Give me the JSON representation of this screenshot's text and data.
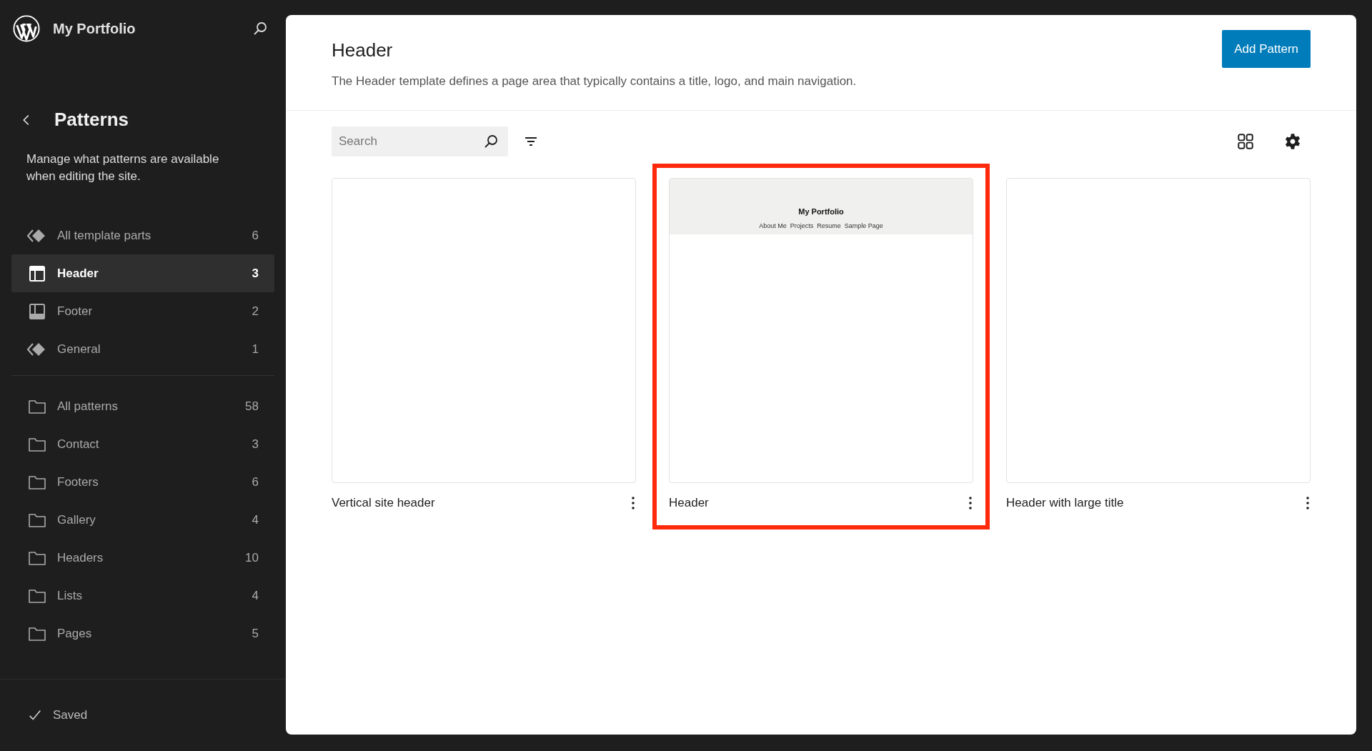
{
  "sidebar": {
    "site_title": "My Portfolio",
    "heading": "Patterns",
    "description": "Manage what patterns are available when editing the site.",
    "template_parts": [
      {
        "kind": "symbol",
        "label": "All template parts",
        "count": "6",
        "selected": false
      },
      {
        "kind": "header",
        "label": "Header",
        "count": "3",
        "selected": true
      },
      {
        "kind": "footer",
        "label": "Footer",
        "count": "2",
        "selected": false
      },
      {
        "kind": "symbol",
        "label": "General",
        "count": "1",
        "selected": false
      }
    ],
    "categories": [
      {
        "label": "All patterns",
        "count": "58",
        "selected": false
      },
      {
        "label": "Contact",
        "count": "3",
        "selected": false
      },
      {
        "label": "Footers",
        "count": "6",
        "selected": false
      },
      {
        "label": "Gallery",
        "count": "4",
        "selected": false
      },
      {
        "label": "Headers",
        "count": "10",
        "selected": false
      },
      {
        "label": "Lists",
        "count": "4",
        "selected": false
      },
      {
        "label": "Pages",
        "count": "5",
        "selected": false
      }
    ],
    "status": "Saved"
  },
  "main": {
    "title": "Header",
    "description": "The Header template defines a page area that typically contains a title, logo, and main navigation.",
    "add_button": "Add Pattern",
    "search": {
      "placeholder": "Search"
    },
    "patterns": [
      {
        "title": "Vertical site header",
        "highlighted": false
      },
      {
        "title": "Header",
        "highlighted": true,
        "preview": {
          "site_title": "My Portfolio",
          "nav": [
            "About Me",
            "Projects",
            "Resume",
            "Sample Page"
          ]
        }
      },
      {
        "title": "Header with large title",
        "highlighted": false
      }
    ]
  }
}
